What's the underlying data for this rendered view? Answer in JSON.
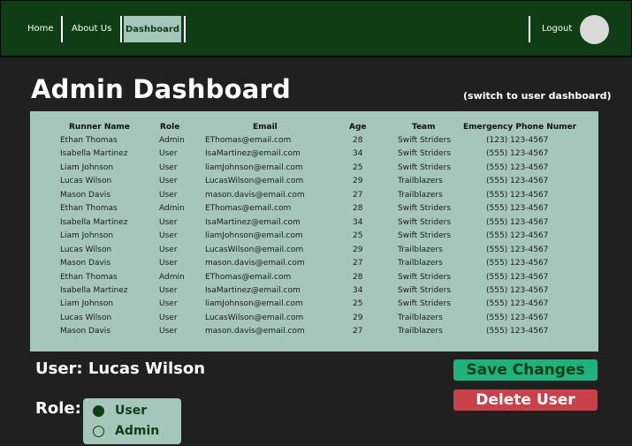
{
  "nav": {
    "home": "Home",
    "about": "About Us",
    "dashboard": "Dashboard",
    "logout": "Logout"
  },
  "page": {
    "title": "Admin Dashboard",
    "switch_link": "(switch to user dashboard)"
  },
  "table": {
    "headers": [
      "Runner Name",
      "Role",
      "Email",
      "Age",
      "Team",
      "Emergency Phone Numer"
    ],
    "rows": [
      [
        "Ethan Thomas",
        "Admin",
        "EThomas@email.com",
        "28",
        "Swift Striders",
        "(123) 123-4567"
      ],
      [
        "Isabella Martinez",
        "User",
        "IsaMartinez@email.com",
        "34",
        "Swift Striders",
        "(555) 123-4567"
      ],
      [
        "Liam Johnson",
        "User",
        "liamJohnson@email.com",
        "25",
        "Swift Striders",
        "(555) 123-4567"
      ],
      [
        "Lucas Wilson",
        "User",
        "LucasWilson@email.com",
        "29",
        "Trailblazers",
        "(555) 123-4567"
      ],
      [
        "Mason Davis",
        "User",
        "mason.davis@email.com",
        "27",
        "Trailblazers",
        "(555) 123-4567"
      ],
      [
        "Ethan Thomas",
        "Admin",
        "EThomas@email.com",
        "28",
        "Swift Striders",
        "(555) 123-4567"
      ],
      [
        "Isabella Martinez",
        "User",
        "IsaMartinez@email.com",
        "34",
        "Swift Striders",
        "(555) 123-4567"
      ],
      [
        "Liam Johnson",
        "User",
        "liamJohnson@email.com",
        "25",
        "Swift Striders",
        "(555) 123-4567"
      ],
      [
        "Lucas Wilson",
        "User",
        "LucasWilson@email.com",
        "29",
        "Trailblazers",
        "(555) 123-4567"
      ],
      [
        "Mason Davis",
        "User",
        "mason.davis@email.com",
        "27",
        "Trailblazers",
        "(555) 123-4567"
      ],
      [
        "Ethan Thomas",
        "Admin",
        "EThomas@email.com",
        "28",
        "Swift Striders",
        "(555) 123-4567"
      ],
      [
        "Isabella Martinez",
        "User",
        "IsaMartinez@email.com",
        "34",
        "Swift Striders",
        "(555) 123-4567"
      ],
      [
        "Liam Johnson",
        "User",
        "liamJohnson@email.com",
        "25",
        "Swift Striders",
        "(555) 123-4567"
      ],
      [
        "Lucas Wilson",
        "User",
        "LucasWilson@email.com",
        "29",
        "Trailblazers",
        "(555) 123-4567"
      ],
      [
        "Mason Davis",
        "User",
        "mason.davis@email.com",
        "27",
        "Trailblazers",
        "(555) 123-4567"
      ]
    ]
  },
  "editor": {
    "user_label": "User: Lucas Wilson",
    "role_label": "Role:",
    "role_options": [
      {
        "label": "User",
        "checked": true
      },
      {
        "label": "Admin",
        "checked": false
      }
    ],
    "save_button": "Save Changes",
    "delete_button": "Delete User"
  },
  "colors": {
    "nav_bg": "#0f3d14",
    "page_bg": "#202020",
    "panel_bg": "#a6c6bb",
    "save_bg": "#1fb27f",
    "delete_bg": "#c9424a"
  }
}
